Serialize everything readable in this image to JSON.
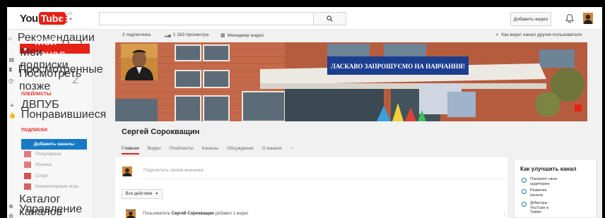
{
  "masthead": {
    "logo_you": "You",
    "logo_tube": "Tube",
    "logo_region": "UA",
    "add_video_label": "Добавить видео"
  },
  "sidebar": {
    "items": [
      {
        "label": "Рекомендации",
        "icon": "home-icon"
      },
      {
        "label": "Мой канал",
        "icon": "my-channel-icon",
        "active": true
      },
      {
        "label": "Мои подписки",
        "icon": "subscriptions-icon"
      },
      {
        "label": "Просмотренные",
        "icon": "history-icon"
      },
      {
        "label": "Посмотреть позже",
        "icon": "watch-later-icon",
        "count": "2"
      }
    ],
    "playlists_heading": "ПЛЕЙЛИСТЫ",
    "playlists": [
      {
        "label": "ДВПУБ",
        "icon": "playlist-icon"
      },
      {
        "label": "Понравившиеся",
        "icon": "like-icon"
      }
    ],
    "subscriptions_heading": "ПОДПИСКИ",
    "add_channels_label": "Добавить каналы",
    "categories": [
      {
        "label": "Популярное"
      },
      {
        "label": "Музыка"
      },
      {
        "label": "Спорт"
      },
      {
        "label": "Компьютерные игры"
      }
    ],
    "footer_items": [
      {
        "label": "Каталог каналов",
        "icon": "catalog-icon"
      },
      {
        "label": "Управление подписка",
        "icon": "manage-icon"
      }
    ]
  },
  "channel": {
    "subscribers": "2 подписчика",
    "views": "1 163 просмотра",
    "video_manager": "Менеджер видео",
    "view_as": "Как видят канал другие пользователи",
    "banner_sign": "ЛАСКАВО ЗАПРОШУЄМО НА НАВЧАННЯ!",
    "name": "Сергей Сорокващин",
    "tabs": [
      "Главная",
      "Видео",
      "Плейлисты",
      "Каналы",
      "Обсуждение",
      "О канале"
    ]
  },
  "feed": {
    "post_placeholder": "Поделитесь своим мнением",
    "all_actions_label": "Все действия",
    "activity_prefix": "Пользователь",
    "activity_user": "Сергей Сорокващин",
    "activity_suffix": "добавил 1 видео"
  },
  "improve": {
    "title": "Как улучшить канал",
    "items": [
      "Покорите свою аудиторию",
      "Развитие канала",
      "@Авторы YouTube в Twitter"
    ]
  },
  "colors": {
    "brand_red": "#e62117",
    "link_blue": "#167ac6"
  }
}
